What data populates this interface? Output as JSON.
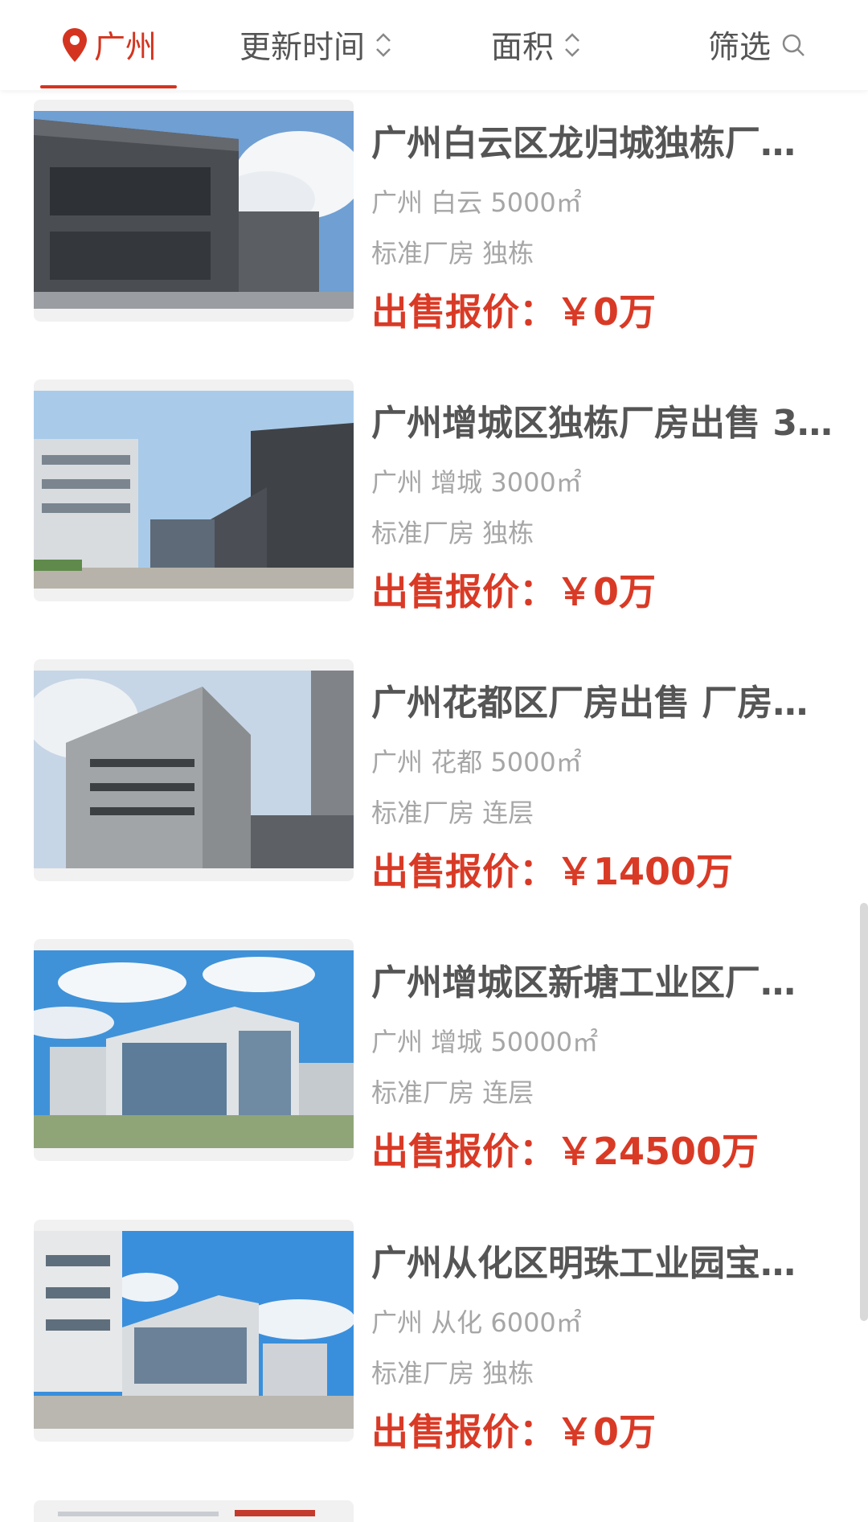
{
  "filter_bar": {
    "city": "广州",
    "update_time": "更新时间",
    "area": "面积",
    "filter": "筛选"
  },
  "listings": [
    {
      "title": "广州白云区龙归城独栋厂…",
      "location_area": "广州 白云 5000㎡",
      "tags": "标准厂房 独栋",
      "price": "出售报价：￥0万"
    },
    {
      "title": "广州增城区独栋厂房出售 3…",
      "location_area": "广州 增城 3000㎡",
      "tags": "标准厂房 独栋",
      "price": "出售报价：￥0万"
    },
    {
      "title": "广州花都区厂房出售 厂房…",
      "location_area": "广州 花都 5000㎡",
      "tags": "标准厂房 连层",
      "price": "出售报价：￥1400万"
    },
    {
      "title": "广州增城区新塘工业区厂…",
      "location_area": "广州 增城 50000㎡",
      "tags": "标准厂房 连层",
      "price": "出售报价：￥24500万"
    },
    {
      "title": "广州从化区明珠工业园宝…",
      "location_area": "广州 从化 6000㎡",
      "tags": "标准厂房 独栋",
      "price": "出售报价：￥0万"
    }
  ],
  "colors": {
    "accent": "#d4341f",
    "price": "#d93a26",
    "title": "#555555",
    "meta": "#a6a6a6"
  }
}
